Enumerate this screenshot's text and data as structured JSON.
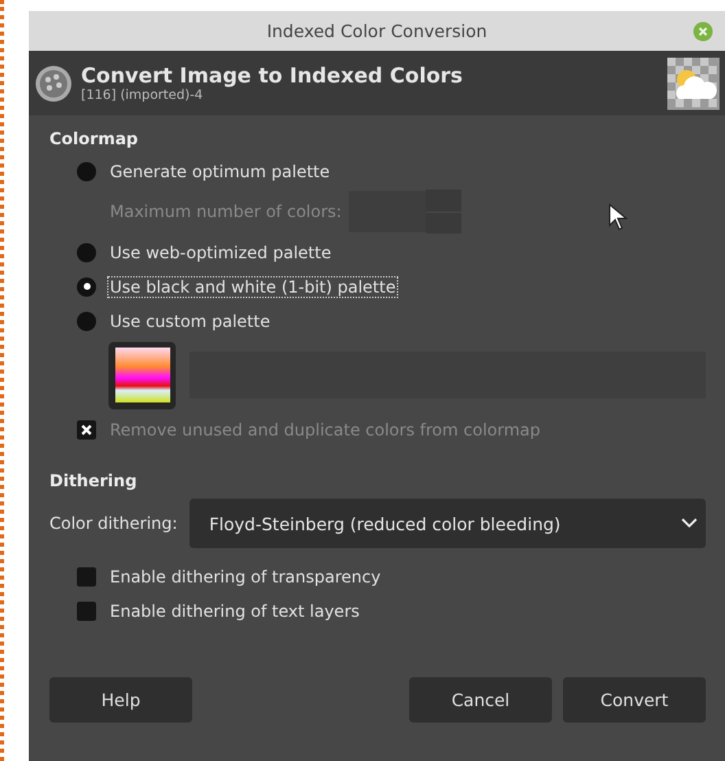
{
  "window": {
    "title": "Indexed Color Conversion"
  },
  "header": {
    "title": "Convert Image to Indexed Colors",
    "subtitle": "[116] (imported)-4"
  },
  "colormap": {
    "heading": "Colormap",
    "options": [
      {
        "kind": "radio",
        "label": "Generate optimum palette",
        "selected": false
      },
      {
        "kind": "spin",
        "label": "Maximum number of colors:",
        "disabled": true
      },
      {
        "kind": "radio",
        "label": "Use web-optimized palette",
        "selected": false
      },
      {
        "kind": "radio",
        "label": "Use black and white (1-bit) palette",
        "selected": true
      },
      {
        "kind": "radio",
        "label": "Use custom palette",
        "selected": false
      },
      {
        "kind": "palette",
        "disabled": true
      }
    ],
    "remove_unused": {
      "label": "Remove unused and duplicate colors from colormap",
      "checked": true,
      "disabled": true
    }
  },
  "dithering": {
    "heading": "Dithering",
    "combo_label": "Color dithering:",
    "combo_value": "Floyd-Steinberg (reduced color bleeding)",
    "checkboxes": [
      {
        "label": "Enable dithering of transparency",
        "checked": false
      },
      {
        "label": "Enable dithering of text layers",
        "checked": false
      }
    ]
  },
  "buttons": [
    {
      "label": "Help",
      "kind": "left"
    },
    {
      "label": "Cancel",
      "kind": "right"
    },
    {
      "label": "Convert",
      "kind": "right"
    }
  ]
}
